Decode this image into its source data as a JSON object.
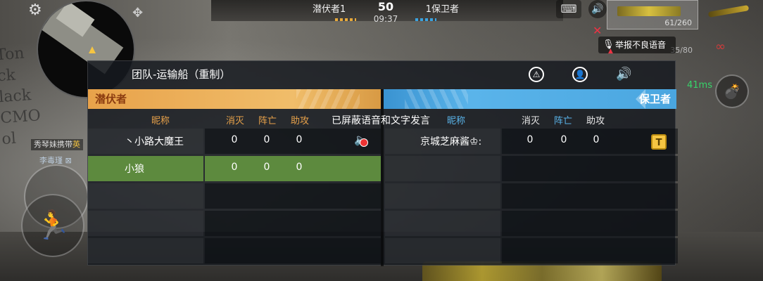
{
  "hud": {
    "score": {
      "left_team_label": "潜伏者1",
      "center_score": "50",
      "right_team_label": "1保卫者",
      "timer": "09:37"
    },
    "weapon_primary_ammo": "61/260",
    "weapon_secondary_ammo": "35/80",
    "report_voice_label": "举报不良语音",
    "ping": "41ms",
    "chat_user": "秀琴妹携带",
    "chat_highlight": "英",
    "chat_line2": "李毒瑾 ⊠",
    "wall_text": [
      "Ton",
      "ck",
      "lack",
      "CMO",
      "ol"
    ]
  },
  "scoreboard": {
    "map_name": "团队-运输船（重制）",
    "left_team": {
      "name": "潜伏者",
      "color": "#e8a24a",
      "headers": {
        "nickname": "昵称",
        "kills": "消灭",
        "deaths": "阵亡",
        "assists": "助攻"
      },
      "players": [
        {
          "name": "丶小路大魔王",
          "kills": "0",
          "deaths": "0",
          "assists": "0"
        },
        {
          "name": "小狼",
          "kills": "0",
          "deaths": "0",
          "assists": "0"
        }
      ]
    },
    "right_team": {
      "name": "保卫者",
      "color": "#4aa6e0",
      "headers": {
        "nickname": "昵称",
        "kills": "消灭",
        "deaths": "阵亡",
        "assists": "助攻"
      },
      "players": [
        {
          "name": "京城芝麻酱♔:",
          "kills": "0",
          "deaths": "0",
          "assists": "0"
        }
      ]
    },
    "mute_tooltip": "已屏蔽语音和文字发言",
    "badge_letter": "T",
    "highlight_color": "#5d8a3e"
  }
}
